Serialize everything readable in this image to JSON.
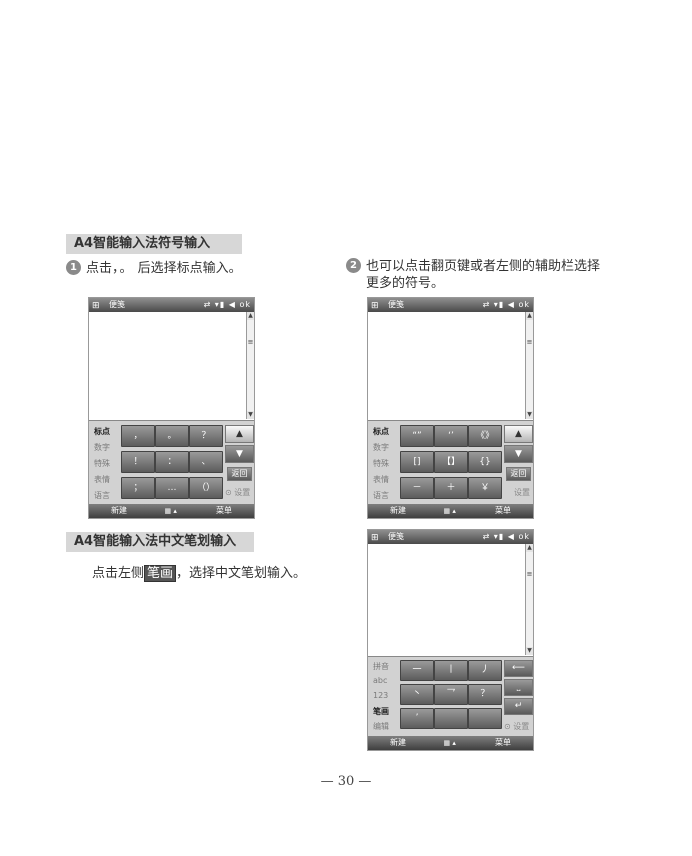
{
  "section1_title": "A4智能输入法符号输入",
  "section2_title": "A4智能输入法中文笔划输入",
  "step1": {
    "num": "1",
    "prefix": "点击",
    "mark": "，。",
    "suffix": " 后选择标点输入。"
  },
  "step2": {
    "num": "2",
    "line1": "也可以点击翻页键或者左侧的辅助栏选择",
    "line2": "更多的符号。"
  },
  "step3": {
    "prefix": "点击左侧",
    "highlight": "笔画",
    "suffix": "，选择中文笔划输入。"
  },
  "phone": {
    "title": "便笺",
    "status": "⇄ ▾▮ ◀ ok",
    "menu_left": "新建",
    "menu_center": "▦ ▴",
    "menu_right": "菜单",
    "settings_label": "设置",
    "back_label": "返回"
  },
  "symbol_side": [
    "标点",
    "数字",
    "特殊",
    "表情",
    "语言"
  ],
  "stroke_side": [
    "拼音",
    "abc",
    "123",
    "笔画",
    "编辑"
  ],
  "kbd1_keys": [
    "，",
    "。",
    "？",
    "！",
    "：",
    "、",
    "；",
    "…",
    "（）"
  ],
  "kbd2_keys": [
    "“”",
    "‘’",
    "《》",
    "[]",
    "【】",
    "{}",
    "－",
    "＋",
    "￥"
  ],
  "kbd3_keys": [
    "一",
    "丨",
    "丿",
    "丶",
    "乛",
    "？",
    "’",
    "",
    ""
  ],
  "page_number": "— 30 —"
}
